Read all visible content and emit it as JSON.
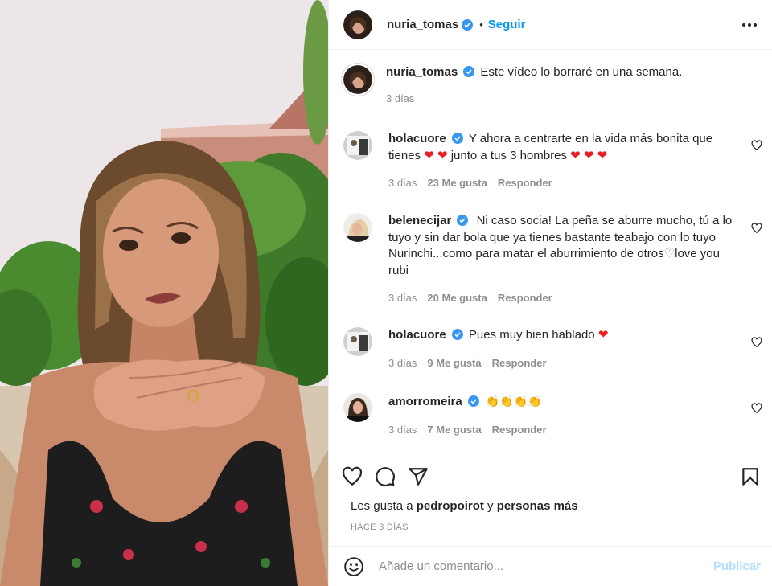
{
  "post": {
    "author": "nuria_tomas",
    "follow_label": "Seguir",
    "dot": "•",
    "caption": "Este vídeo lo borraré en una semana.",
    "caption_time": "3 días"
  },
  "comments": [
    {
      "user": "holacuore",
      "text": "Y ahora a centrarte en la vida más bonita que tienes ",
      "text2": " junto a tus 3 hombres ",
      "time": "3 días",
      "likes": "23 Me gusta",
      "reply": "Responder"
    },
    {
      "user": "belenecijar",
      "text": "Ni caso socia! La peña se aburre mucho, tú a lo tuyo y sin dar bola que ya tienes bastante teabajo con lo tuyo Nurinchi...como para matar el aburrimiento de otros",
      "text2": "love you rubi",
      "time": "3 días",
      "likes": "20 Me gusta",
      "reply": "Responder"
    },
    {
      "user": "holacuore",
      "text": "Pues muy bien hablado ",
      "time": "3 días",
      "likes": "9 Me gusta",
      "reply": "Responder"
    },
    {
      "user": "amorromeira",
      "text": "",
      "time": "3 días",
      "likes": "7 Me gusta",
      "reply": "Responder"
    }
  ],
  "likes_line": {
    "prefix": "Les gusta a ",
    "user": "pedropoirot",
    "middle": " y ",
    "others": "personas más"
  },
  "posted_ago": "HACE 3 DÍAS",
  "comment_box": {
    "placeholder": "Añade un comentario...",
    "publish_label": "Publicar"
  },
  "emoji": {
    "red_heart": "❤",
    "white_heart": "♡",
    "clap": "👏"
  },
  "icons": {
    "verified": "verified-badge-icon",
    "like": "heart-outline-icon",
    "comment": "speech-bubble-icon",
    "share": "paper-plane-icon",
    "save": "bookmark-icon",
    "emoji": "smiley-face-icon",
    "more": "more-options-icon"
  },
  "colors": {
    "accent": "#0095f6",
    "publish_disabled": "#b2dffc",
    "verified": "#3897f0",
    "heart_red": "#ed1c24",
    "muted": "#8e8e8e"
  }
}
